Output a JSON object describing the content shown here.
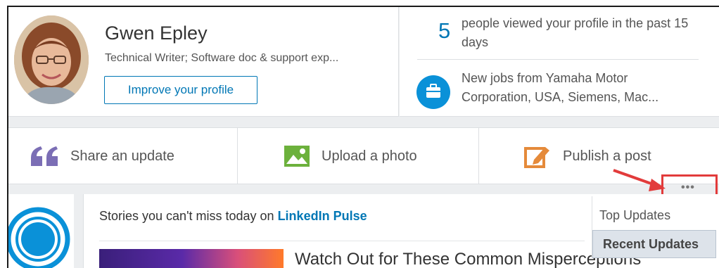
{
  "profile": {
    "name": "Gwen Epley",
    "headline": "Technical Writer; Software doc & support exp...",
    "improve_label": "Improve your profile"
  },
  "stats": {
    "views_count": "5",
    "views_text": "people viewed your profile in the past 15 days",
    "jobs_text": "New jobs from Yamaha Motor Corporation, USA, Siemens, Mac..."
  },
  "share": {
    "update_label": "Share an update",
    "photo_label": "Upload a photo",
    "post_label": "Publish a post"
  },
  "more_label": "•••",
  "feed": {
    "pulse_prefix": "Stories you can't miss today on ",
    "pulse_link": "LinkedIn Pulse",
    "article_title": "Watch Out for These Common Misperceptions"
  },
  "sort": {
    "options": [
      "Top Updates",
      "Recent Updates"
    ],
    "selected": "Recent Updates"
  },
  "colors": {
    "accent": "#0077b5",
    "quote_icon": "#7b6eb5",
    "photo_icon": "#6cb13c",
    "post_icon": "#e58a3a",
    "annotation": "#e23b3b"
  },
  "icons": [
    "quote-icon",
    "photo-icon",
    "pencil-icon",
    "briefcase-icon",
    "more-icon",
    "arrow-annotation"
  ]
}
